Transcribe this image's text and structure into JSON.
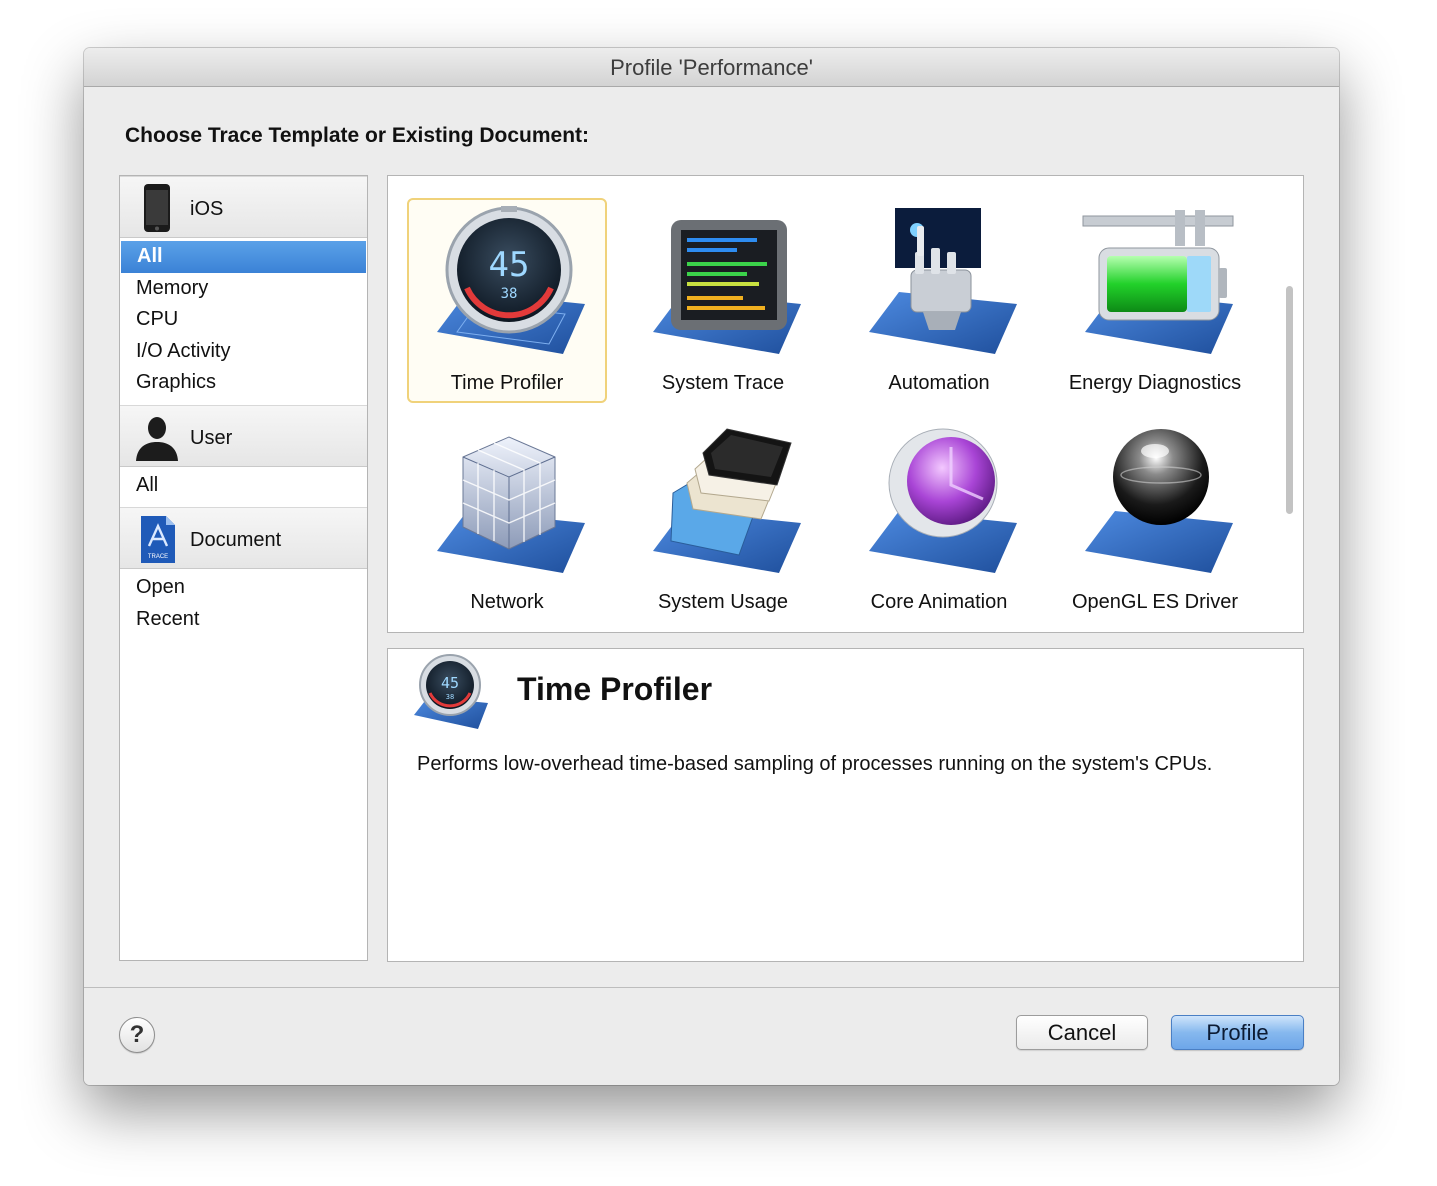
{
  "window": {
    "title": "Profile 'Performance'"
  },
  "heading": "Choose Trace Template or Existing Document:",
  "sidebar": {
    "groups": [
      {
        "label": "iOS",
        "icon": "iphone-icon",
        "items": [
          "All",
          "Memory",
          "CPU",
          "I/O Activity",
          "Graphics"
        ],
        "selected": "All"
      },
      {
        "label": "User",
        "icon": "user-silhouette-icon",
        "items": [
          "All"
        ]
      },
      {
        "label": "Document",
        "icon": "trace-document-icon",
        "icon_text": "TRACE",
        "items": [
          "Open",
          "Recent"
        ]
      }
    ]
  },
  "templates": [
    {
      "label": "Time Profiler",
      "icon": "stopwatch-icon",
      "selected": true,
      "gauge_major": "45",
      "gauge_minor": "38"
    },
    {
      "label": "System Trace",
      "icon": "system-trace-icon"
    },
    {
      "label": "Automation",
      "icon": "automation-robot-icon"
    },
    {
      "label": "Energy Diagnostics",
      "icon": "battery-caliper-icon"
    },
    {
      "label": "Network",
      "icon": "network-cube-icon"
    },
    {
      "label": "System Usage",
      "icon": "devices-stack-icon"
    },
    {
      "label": "Core Animation",
      "icon": "core-animation-sphere-icon"
    },
    {
      "label": "OpenGL ES Driver",
      "icon": "opengl-sphere-icon"
    }
  ],
  "description": {
    "title": "Time Profiler",
    "text": "Performs low-overhead time-based sampling of processes running on the system's CPUs."
  },
  "footer": {
    "help_label": "?",
    "cancel_label": "Cancel",
    "profile_label": "Profile"
  },
  "colors": {
    "selection_blue": "#3b82d6",
    "tile_selection_border": "#f0d27a",
    "blueprint_blue": "#2a63b8"
  }
}
